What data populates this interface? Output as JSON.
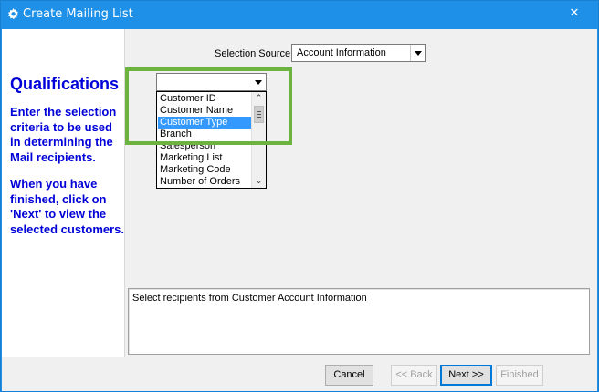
{
  "window": {
    "title": "Create Mailing List",
    "close_glyph": "✕",
    "title_icon": "envelope-gear-icon",
    "accent_color": "#1e90e8"
  },
  "left_panel": {
    "heading": "Qualifications",
    "instruction_1": "Enter the selection criteria to be used in determining the Mail recipients.",
    "instruction_2": "When you have finished, click on 'Next' to view the selected customers.",
    "text_color": "#0000d8"
  },
  "selection_source": {
    "label": "Selection Source",
    "value": "Account Information"
  },
  "field_dropdown": {
    "value": "",
    "options": [
      "Customer ID",
      "Customer Name",
      "Customer Type",
      "Branch",
      "Salesperson",
      "Marketing List",
      "Marketing Code",
      "Number of Orders"
    ],
    "selected_option": "Customer Type",
    "highlight_color": "#6db33f"
  },
  "description": {
    "text": "Select recipients from Customer Account Information"
  },
  "buttons": {
    "cancel": "Cancel",
    "back": "<< Back",
    "next": "Next >>",
    "finished": "Finished"
  }
}
